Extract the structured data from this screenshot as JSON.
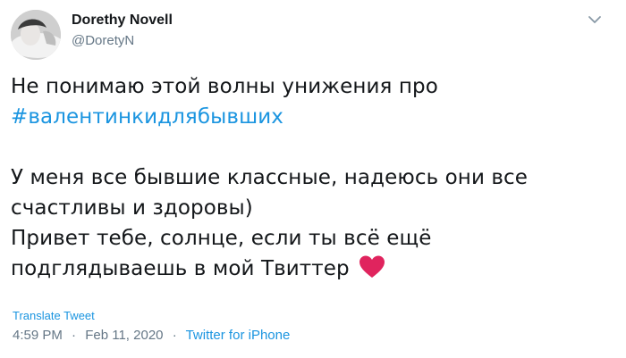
{
  "author": {
    "display_name": "Dorethy Novell",
    "handle": "@DoretyN"
  },
  "tweet": {
    "line1": "Не понимаю этой волны унижения про",
    "hashtag": "#валентинкидлябывших",
    "line3": "У меня все бывшие классные, надеюсь они все",
    "line4": "счастливы и здоровы)",
    "line5": "Привет тебе, солнце, если ты всё ещё",
    "line6": "подглядываешь в мой Твиттер",
    "emoji": "heart-icon"
  },
  "translate_label": "Translate Tweet",
  "meta": {
    "time": "4:59 PM",
    "date": "Feb 11, 2020",
    "separator": "·",
    "source": "Twitter for iPhone"
  },
  "colors": {
    "link": "#1b95e0",
    "secondary": "#657786",
    "text": "#14171a",
    "heart": "#e0245e"
  }
}
